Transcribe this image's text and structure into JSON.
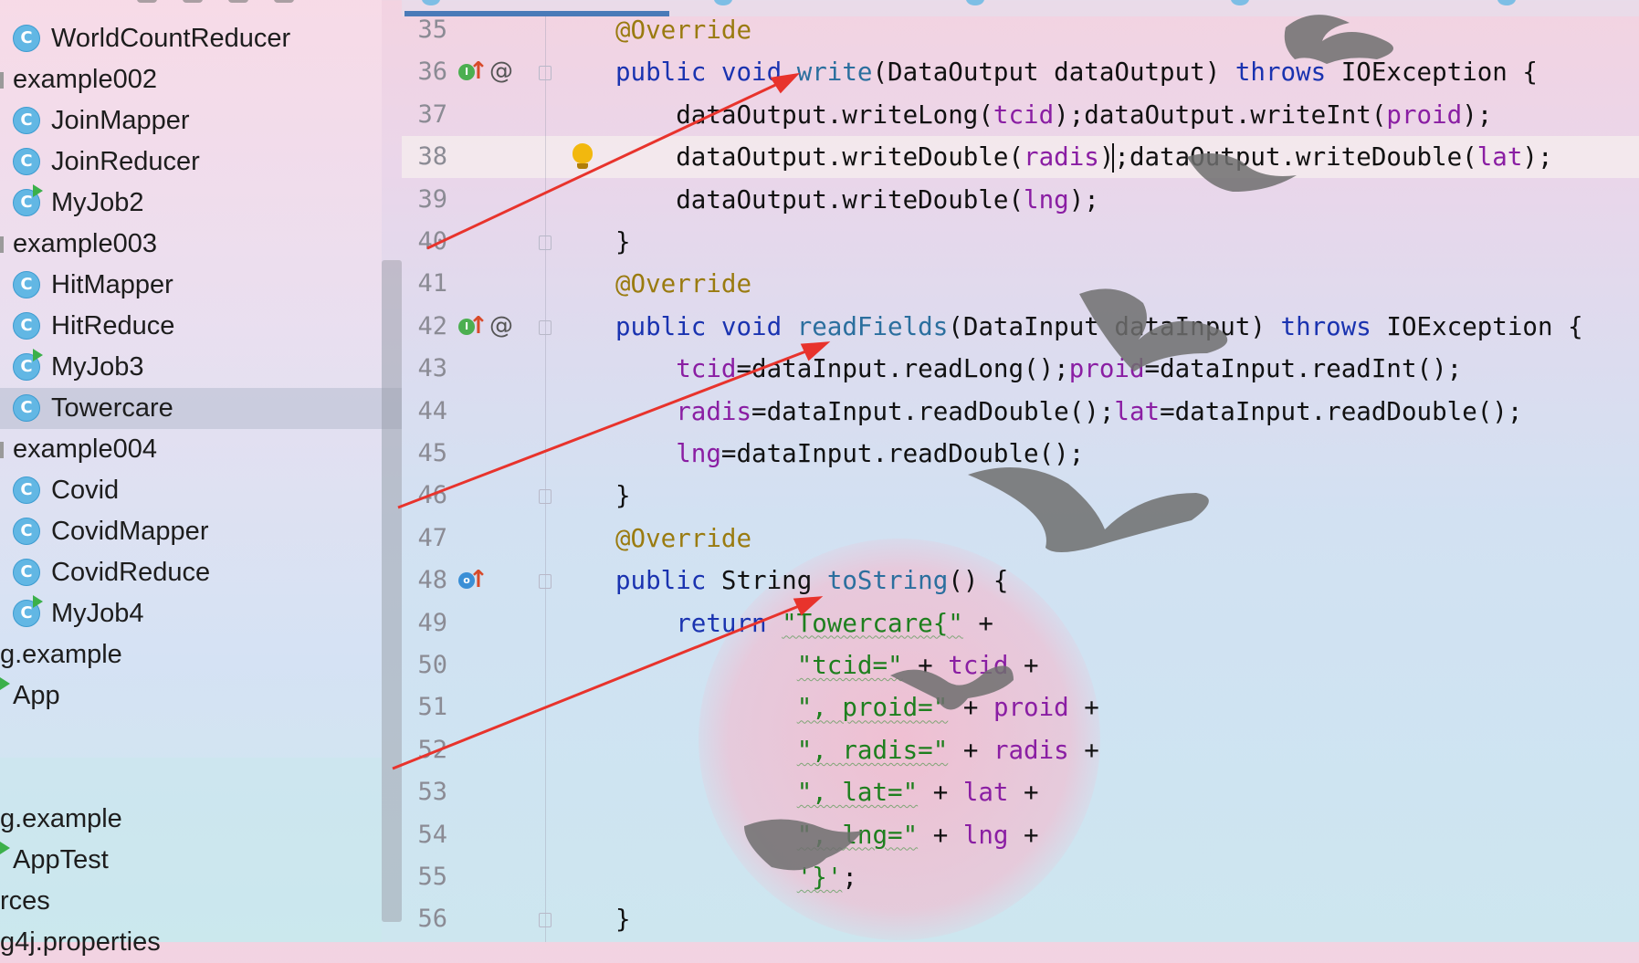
{
  "project_tree": {
    "items": [
      {
        "label": "WorldCountReducer",
        "kind": "class",
        "indent": 1,
        "run": false
      },
      {
        "label": "example002",
        "kind": "package",
        "indent": 0,
        "run": false
      },
      {
        "label": "JoinMapper",
        "kind": "class",
        "indent": 1,
        "run": false
      },
      {
        "label": "JoinReducer",
        "kind": "class",
        "indent": 1,
        "run": false
      },
      {
        "label": "MyJob2",
        "kind": "class",
        "indent": 1,
        "run": true
      },
      {
        "label": "example003",
        "kind": "package",
        "indent": 0,
        "run": false
      },
      {
        "label": "HitMapper",
        "kind": "class",
        "indent": 1,
        "run": false
      },
      {
        "label": "HitReduce",
        "kind": "class",
        "indent": 1,
        "run": false
      },
      {
        "label": "MyJob3",
        "kind": "class",
        "indent": 1,
        "run": true
      },
      {
        "label": "Towercare",
        "kind": "class",
        "indent": 1,
        "run": false,
        "selected": true
      },
      {
        "label": "example004",
        "kind": "package",
        "indent": 0,
        "run": false
      },
      {
        "label": "Covid",
        "kind": "class",
        "indent": 1,
        "run": false
      },
      {
        "label": "CovidMapper",
        "kind": "class",
        "indent": 1,
        "run": false
      },
      {
        "label": "CovidReduce",
        "kind": "class",
        "indent": 1,
        "run": false
      },
      {
        "label": "MyJob4",
        "kind": "class",
        "indent": 1,
        "run": true
      },
      {
        "label": "g.example",
        "kind": "package-cut",
        "indent": 0,
        "run": false
      },
      {
        "label": "App",
        "kind": "class-cut",
        "indent": 0,
        "run": true
      },
      {
        "label": "",
        "kind": "blank",
        "indent": 0,
        "run": false
      },
      {
        "label": "",
        "kind": "blank",
        "indent": 0,
        "run": false
      },
      {
        "label": "g.example",
        "kind": "package-cut",
        "indent": 0,
        "run": false
      },
      {
        "label": "AppTest",
        "kind": "class-cut",
        "indent": 0,
        "run": true
      },
      {
        "label": "rces",
        "kind": "package-cut",
        "indent": 0,
        "run": false
      },
      {
        "label": "g4j.properties",
        "kind": "file-cut",
        "indent": 0,
        "run": false
      }
    ],
    "class_icon_letter": "C",
    "icon_names": {
      "class": "java-class-icon",
      "run": "run-config-icon"
    }
  },
  "editor": {
    "lines": [
      {
        "n": "35",
        "tokens": [
          [
            "ann",
            "@Override"
          ]
        ]
      },
      {
        "n": "36",
        "tokens": [
          [
            "kw",
            "public void "
          ],
          [
            "fn",
            "write"
          ],
          [
            "p",
            "(DataOutput dataOutput) "
          ],
          [
            "kw",
            "throws"
          ],
          [
            "p",
            " IOException {"
          ]
        ]
      },
      {
        "n": "37",
        "tokens": [
          [
            "p",
            "    dataOutput.writeLong("
          ],
          [
            "fld",
            "tcid"
          ],
          [
            "p",
            ");dataOutput.writeInt("
          ],
          [
            "fld",
            "proid"
          ],
          [
            "p",
            ");"
          ]
        ]
      },
      {
        "n": "38",
        "tokens": [
          [
            "p",
            "    dataOutput.writeDouble("
          ],
          [
            "fld",
            "radis"
          ],
          [
            "p",
            ");dataOutput.writeDouble("
          ],
          [
            "fld",
            "lat"
          ],
          [
            "p",
            ");"
          ]
        ]
      },
      {
        "n": "39",
        "tokens": [
          [
            "p",
            "    dataOutput.writeDouble("
          ],
          [
            "fld",
            "lng"
          ],
          [
            "p",
            ");"
          ]
        ]
      },
      {
        "n": "40",
        "tokens": [
          [
            "p",
            "}"
          ]
        ]
      },
      {
        "n": "41",
        "tokens": [
          [
            "ann",
            "@Override"
          ]
        ]
      },
      {
        "n": "42",
        "tokens": [
          [
            "kw",
            "public void "
          ],
          [
            "fn",
            "readFields"
          ],
          [
            "p",
            "(DataInput dataInput) "
          ],
          [
            "kw",
            "throws"
          ],
          [
            "p",
            " IOException {"
          ]
        ]
      },
      {
        "n": "43",
        "tokens": [
          [
            "p",
            "    "
          ],
          [
            "fld",
            "tcid"
          ],
          [
            "p",
            "=dataInput.readLong();"
          ],
          [
            "fld",
            "proid"
          ],
          [
            "p",
            "=dataInput.readInt();"
          ]
        ]
      },
      {
        "n": "44",
        "tokens": [
          [
            "p",
            "    "
          ],
          [
            "fld",
            "radis"
          ],
          [
            "p",
            "=dataInput.readDouble();"
          ],
          [
            "fld",
            "lat"
          ],
          [
            "p",
            "=dataInput.readDouble();"
          ]
        ]
      },
      {
        "n": "45",
        "tokens": [
          [
            "p",
            "    "
          ],
          [
            "fld",
            "lng"
          ],
          [
            "p",
            "=dataInput.readDouble();"
          ]
        ]
      },
      {
        "n": "46",
        "tokens": [
          [
            "p",
            "}"
          ]
        ]
      },
      {
        "n": "47",
        "tokens": [
          [
            "ann",
            "@Override"
          ]
        ]
      },
      {
        "n": "48",
        "tokens": [
          [
            "kw",
            "public "
          ],
          [
            "p",
            "String "
          ],
          [
            "fn",
            "toString"
          ],
          [
            "p",
            "() {"
          ]
        ]
      },
      {
        "n": "49",
        "tokens": [
          [
            "kw",
            "    return "
          ],
          [
            "str",
            "\"Towercare{\""
          ],
          [
            "p",
            " +"
          ]
        ]
      },
      {
        "n": "50",
        "tokens": [
          [
            "p",
            "            "
          ],
          [
            "str",
            "\"tcid=\""
          ],
          [
            "p",
            " + "
          ],
          [
            "fld",
            "tcid"
          ],
          [
            "p",
            " +"
          ]
        ]
      },
      {
        "n": "51",
        "tokens": [
          [
            "p",
            "            "
          ],
          [
            "str",
            "\", proid=\""
          ],
          [
            "p",
            " + "
          ],
          [
            "fld",
            "proid"
          ],
          [
            "p",
            " +"
          ]
        ]
      },
      {
        "n": "52",
        "tokens": [
          [
            "p",
            "            "
          ],
          [
            "str",
            "\", radis=\""
          ],
          [
            "p",
            " + "
          ],
          [
            "fld",
            "radis"
          ],
          [
            "p",
            " +"
          ]
        ]
      },
      {
        "n": "53",
        "tokens": [
          [
            "p",
            "            "
          ],
          [
            "str",
            "\", lat=\""
          ],
          [
            "p",
            " + "
          ],
          [
            "fld",
            "lat"
          ],
          [
            "p",
            " +"
          ]
        ]
      },
      {
        "n": "54",
        "tokens": [
          [
            "p",
            "            "
          ],
          [
            "str",
            "\", lng=\""
          ],
          [
            "p",
            " + "
          ],
          [
            "fld",
            "lng"
          ],
          [
            "p",
            " +"
          ]
        ]
      },
      {
        "n": "55",
        "tokens": [
          [
            "p",
            "            "
          ],
          [
            "str",
            "'}'"
          ],
          [
            "p",
            ";"
          ]
        ]
      },
      {
        "n": "56",
        "tokens": [
          [
            "p",
            "}"
          ]
        ]
      }
    ],
    "current_line": "38",
    "gutter_markers": {
      "implement_badge_letter": "I",
      "override_badge_letter": "o",
      "annotation_symbol": "@",
      "up_arrow": "↑"
    }
  },
  "colors": {
    "annotation": "#9a7b10",
    "keyword": "#1a33b0",
    "method": "#2b6f9e",
    "field": "#8a1ea3",
    "string": "#1e7f1e",
    "arrow": "#e8332c"
  }
}
